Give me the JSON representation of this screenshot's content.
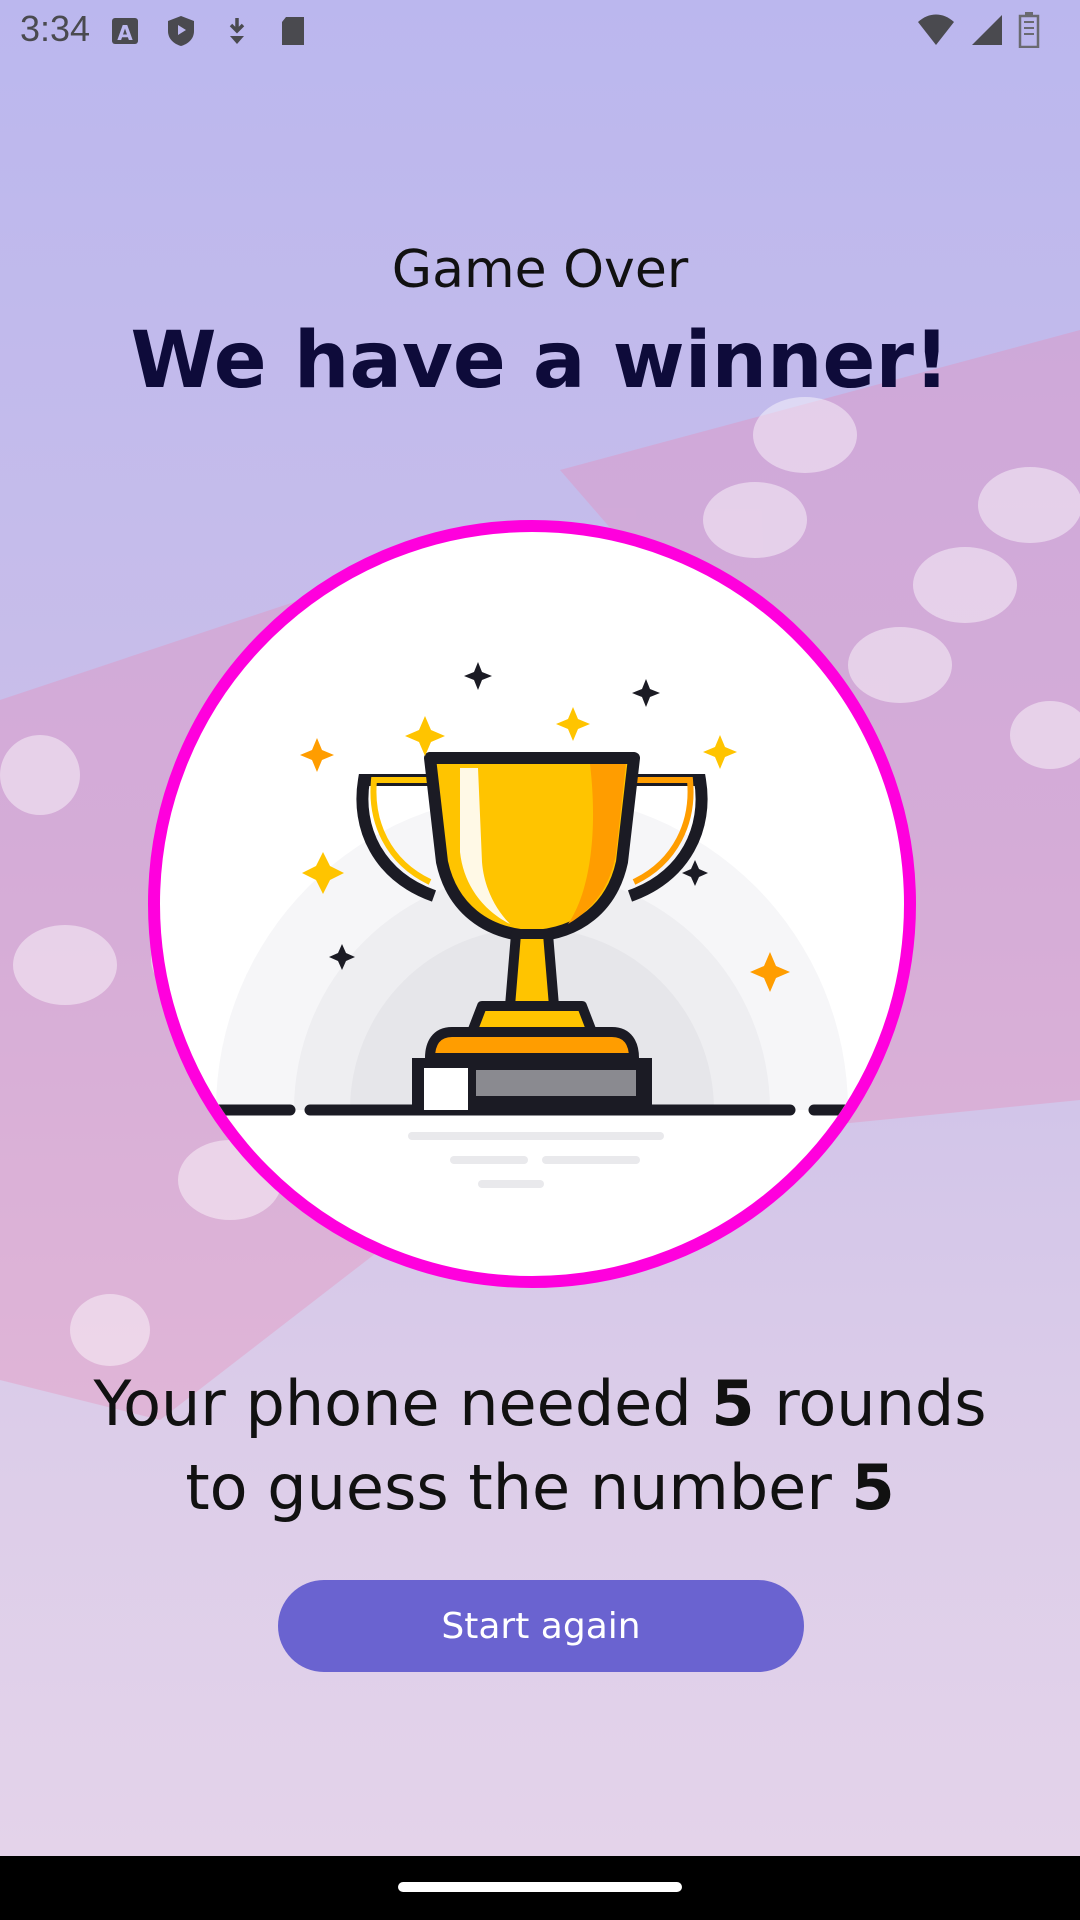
{
  "status_bar": {
    "time": "3:34",
    "left_icons": [
      "font-a-icon",
      "shield-icon",
      "download-icon",
      "sd-card-icon"
    ],
    "right_icons": [
      "wifi-icon",
      "signal-icon",
      "battery-icon"
    ]
  },
  "header": {
    "subtitle": "Game Over",
    "title": "We have a winner!"
  },
  "result": {
    "line1_prefix": "Your phone needed ",
    "rounds": "5",
    "line1_suffix": " rounds",
    "line2_prefix": "to guess the number ",
    "number": "5"
  },
  "actions": {
    "start_again_label": "Start again"
  },
  "colors": {
    "accent": "#6a63d0",
    "circle_border": "#ff00dd",
    "title": "#0e0b3a"
  }
}
